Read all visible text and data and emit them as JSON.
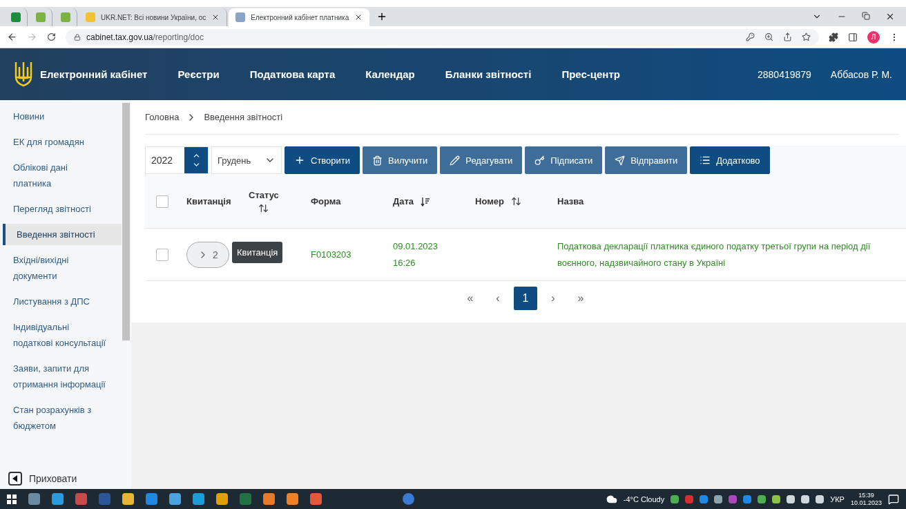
{
  "browser": {
    "tabs": [
      {
        "kind": "pinned",
        "selected": false
      },
      {
        "kind": "pinned",
        "selected": false
      },
      {
        "kind": "pinned",
        "selected": false
      },
      {
        "kind": "page",
        "title": "UKR.NET: Всі новини України, ос",
        "selected": false
      },
      {
        "kind": "page",
        "title": "Електронний кабінет платника",
        "selected": true
      }
    ],
    "address": {
      "host": "cabinet.tax.gov.ua",
      "path": "/reporting/doc"
    },
    "profile_initial": "Л"
  },
  "header": {
    "logo_text": "Електронний кабінет",
    "nav": [
      "Реєстри",
      "Податкова карта",
      "Календар",
      "Бланки звітності",
      "Прес-центр"
    ],
    "taxpayer_id": "2880419879",
    "user": "Аббасов Р. М."
  },
  "sidebar": {
    "items": [
      {
        "label": "Новини",
        "selected": false
      },
      {
        "label": "ЕК для громадян",
        "selected": false
      },
      {
        "label": "Облікові дані платника",
        "selected": false
      },
      {
        "label": "Перегляд звітності",
        "selected": false
      },
      {
        "label": "Введення звітності",
        "selected": true
      },
      {
        "label": "Вхідні/вихідні документи",
        "selected": false
      },
      {
        "label": "Листування з ДПС",
        "selected": false
      },
      {
        "label": "Індивідуальні податкові консультації",
        "selected": false
      },
      {
        "label": "Заяви, запити для отримання інформації",
        "selected": false
      },
      {
        "label": "Стан розрахунків з бюджетом",
        "selected": false
      }
    ],
    "hide_label": "Приховати"
  },
  "breadcrumbs": [
    "Головна",
    "Введення звітності"
  ],
  "toolbar": {
    "year": "2022",
    "month": "Грудень",
    "buttons": [
      {
        "kind": "plus",
        "label": "Створити",
        "disabled": false
      },
      {
        "kind": "trash",
        "label": "Вилучити",
        "disabled": true
      },
      {
        "kind": "pencil",
        "label": "Редагувати",
        "disabled": true
      },
      {
        "kind": "key",
        "label": "Підписати",
        "disabled": true
      },
      {
        "kind": "send",
        "label": "Відправити",
        "disabled": true
      },
      {
        "kind": "list",
        "label": "Додатково",
        "disabled": false
      }
    ]
  },
  "table": {
    "all_checked": false,
    "columns": [
      {
        "label": "Квитанція",
        "kind": "plain"
      },
      {
        "label": "Статус",
        "kind": "sortable"
      },
      {
        "label": "Форма",
        "kind": "plain"
      },
      {
        "label": "Дата",
        "kind": "sorted-desc"
      },
      {
        "label": "Номер",
        "kind": "sortable"
      },
      {
        "label": "Назва",
        "kind": "plain"
      }
    ],
    "rows": [
      {
        "checked": false,
        "receipts": "2",
        "tooltip": "Квитанція",
        "form": "F0103203",
        "date": "09.01.2023",
        "time": "16:26",
        "name": "Податкова декларації платника єдиного податку третьої групи на період дії воєнного, надзвичайного стану в Україні"
      }
    ]
  },
  "pagination": {
    "first": "«",
    "prev": "‹",
    "pages": [
      {
        "label": "1",
        "selected": true
      }
    ],
    "next": "›",
    "last": "»"
  },
  "taskbar": {
    "weather": "-4°C Cloudy",
    "language": "УКР",
    "time": "15:39",
    "date": "10.01.2023"
  }
}
